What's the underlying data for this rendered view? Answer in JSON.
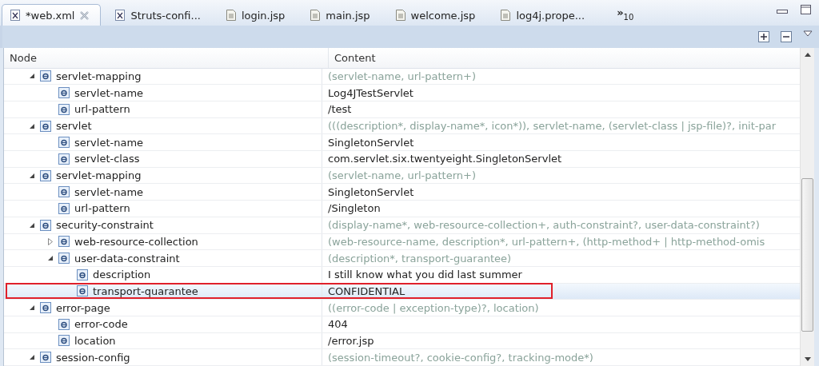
{
  "tabs": [
    {
      "label": "*web.xml",
      "kind": "xml",
      "selected": true
    },
    {
      "label": "Struts-confi...",
      "kind": "xml",
      "selected": false
    },
    {
      "label": "login.jsp",
      "kind": "file",
      "selected": false
    },
    {
      "label": "main.jsp",
      "kind": "file",
      "selected": false
    },
    {
      "label": "welcome.jsp",
      "kind": "file",
      "selected": false
    },
    {
      "label": "log4j.prope...",
      "kind": "file",
      "selected": false
    }
  ],
  "overflow": {
    "symbol": "»",
    "count": "10"
  },
  "tree": {
    "columns": [
      "Node",
      "Content"
    ],
    "nodes": [
      {
        "name": "servlet-mapping",
        "content": "(servlet-name, url-pattern+)",
        "kind": "hint",
        "expanded": true,
        "selected": false,
        "children": [
          {
            "name": "servlet-name",
            "content": "Log4JTestServlet",
            "kind": "value",
            "selected": false
          },
          {
            "name": "url-pattern",
            "content": "/test",
            "kind": "value",
            "selected": false
          }
        ]
      },
      {
        "name": "servlet",
        "content": "(((description*, display-name*, icon*)), servlet-name, (servlet-class | jsp-file)?, init-par",
        "kind": "hint",
        "expanded": true,
        "selected": false,
        "children": [
          {
            "name": "servlet-name",
            "content": "SingletonServlet",
            "kind": "value",
            "selected": false
          },
          {
            "name": "servlet-class",
            "content": "com.servlet.six.twentyeight.SingletonServlet",
            "kind": "value",
            "selected": false
          }
        ]
      },
      {
        "name": "servlet-mapping",
        "content": "(servlet-name, url-pattern+)",
        "kind": "hint",
        "expanded": true,
        "selected": false,
        "children": [
          {
            "name": "servlet-name",
            "content": "SingletonServlet",
            "kind": "value",
            "selected": false
          },
          {
            "name": "url-pattern",
            "content": "/Singleton",
            "kind": "value",
            "selected": false
          }
        ]
      },
      {
        "name": "security-constraint",
        "content": "(display-name*, web-resource-collection+, auth-constraint?, user-data-constraint?)",
        "kind": "hint",
        "expanded": true,
        "selected": false,
        "children": [
          {
            "name": "web-resource-collection",
            "content": "(web-resource-name, description*, url-pattern+, (http-method+ | http-method-omis",
            "kind": "hint",
            "expanded": false,
            "selected": false
          },
          {
            "name": "user-data-constraint",
            "content": "(description*, transport-guarantee)",
            "kind": "hint",
            "expanded": true,
            "selected": false,
            "children": [
              {
                "name": "description",
                "content": "I still know what you did last summer",
                "kind": "value",
                "selected": false
              },
              {
                "name": "transport-quarantee",
                "content": "CONFIDENTIAL",
                "kind": "value",
                "selected": true
              }
            ]
          }
        ]
      },
      {
        "name": "error-page",
        "content": "((error-code | exception-type)?, location)",
        "kind": "hint",
        "expanded": true,
        "selected": false,
        "children": [
          {
            "name": "error-code",
            "content": "404",
            "kind": "value",
            "selected": false
          },
          {
            "name": "location",
            "content": "/error.jsp",
            "kind": "value",
            "selected": false
          }
        ]
      },
      {
        "name": "session-config",
        "content": "(session-timeout?, cookie-config?, tracking-mode*)",
        "kind": "hint",
        "expanded": true,
        "selected": false
      }
    ]
  }
}
